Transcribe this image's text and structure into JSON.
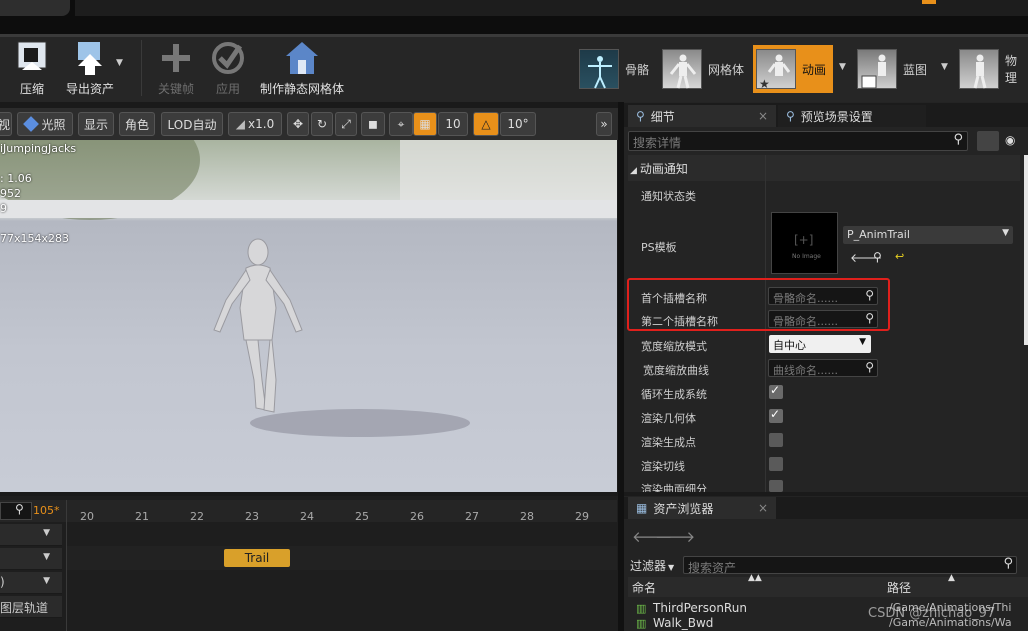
{
  "toolbar": {
    "compress": "压缩",
    "export_asset": "导出资产",
    "key_frame": "关键帧",
    "apply": "应用",
    "make_static_mesh": "制作静态网格体"
  },
  "modes": {
    "skeleton": "骨骼",
    "mesh": "网格体",
    "animation": "动画",
    "blueprint": "蓝图",
    "physics": "物理"
  },
  "viewport_toolbar": {
    "view": "视",
    "lit": "光照",
    "show": "显示",
    "character": "角色",
    "lod": "LOD自动",
    "speed": "x1.0",
    "grid_snap": "10",
    "angle_snap": "10°"
  },
  "viewport_overlay": {
    "anim_name": "iJumpingJacks",
    "rate": ": 1.06",
    "line2": "952",
    "line3": "9",
    "bounds": "77x154x283"
  },
  "timeline": {
    "current_frame": "105*",
    "ticks": [
      "20",
      "21",
      "22",
      "23",
      "24",
      "25",
      "26",
      "27",
      "28",
      "29"
    ],
    "track_labels": [
      "",
      "",
      ")",
      "图层轨道"
    ],
    "notify_label": "Trail"
  },
  "details": {
    "tab_details": "细节",
    "tab_preview": "预览场景设置",
    "search_placeholder": "搜索详情",
    "section": "动画通知",
    "notify_state_class": "通知状态类",
    "ps_template": "PS模板",
    "ps_value": "P_AnimTrail",
    "no_image": "No Image",
    "first_socket": "首个插槽名称",
    "second_socket": "第二个插槽名称",
    "bone_placeholder": "骨骼命名......",
    "width_scale_mode": "宽度缩放模式",
    "width_scale_value": "自中心",
    "width_scale_curve": "宽度缩放曲线",
    "curve_placeholder": "曲线命名......",
    "loop_system": "循环生成系统",
    "render_geometry": "渲染几何体",
    "render_spawn_points": "渲染生成点",
    "render_tangents": "渲染切线",
    "render_tessellation": "渲染曲面细分"
  },
  "asset_browser": {
    "tab": "资产浏览器",
    "filter": "过滤器",
    "search_placeholder": "搜索资产",
    "col_name": "命名",
    "col_path": "路径",
    "rows": [
      {
        "name": "ThirdPersonRun",
        "path": "/Game/Animations/Thi"
      },
      {
        "name": "Walk_Bwd",
        "path": "/Game/Animations/Wa"
      }
    ]
  },
  "watermark": "CSDN @zhichao_97",
  "colors": {
    "accent_orange": "#e8901a",
    "highlight_red": "#e0201c",
    "mode_active": "#e8901a"
  }
}
